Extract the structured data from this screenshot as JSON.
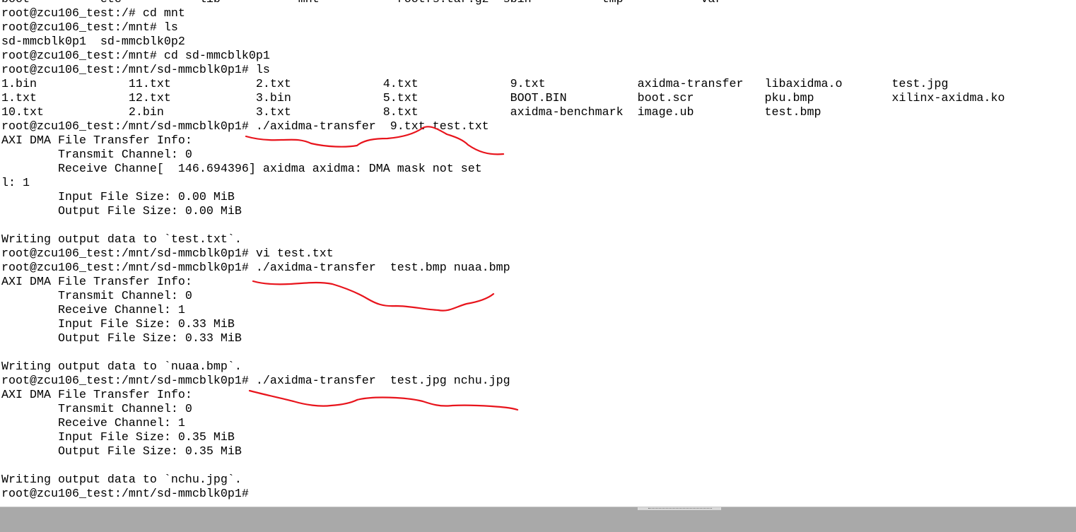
{
  "terminal": {
    "lines": [
      "boot          etc           lib           mnt           rootfs.tar.gz  sbin          tmp           var",
      "root@zcu106_test:/# cd mnt",
      "root@zcu106_test:/mnt# ls",
      "sd-mmcblk0p1  sd-mmcblk0p2",
      "root@zcu106_test:/mnt# cd sd-mmcblk0p1",
      "root@zcu106_test:/mnt/sd-mmcblk0p1# ls",
      "1.bin             11.txt            2.txt             4.txt             9.txt             axidma-transfer   libaxidma.o       test.jpg",
      "1.txt             12.txt            3.bin             5.txt             BOOT.BIN          boot.scr          pku.bmp           xilinx-axidma.ko",
      "10.txt            2.bin             3.txt             8.txt             axidma-benchmark  image.ub          test.bmp",
      "root@zcu106_test:/mnt/sd-mmcblk0p1# ./axidma-transfer  9.txt test.txt",
      "AXI DMA File Transfer Info:",
      "        Transmit Channel: 0",
      "        Receive Channe[  146.694396] axidma axidma: DMA mask not set",
      "l: 1",
      "        Input File Size: 0.00 MiB",
      "        Output File Size: 0.00 MiB",
      "",
      "Writing output data to `test.txt`.",
      "root@zcu106_test:/mnt/sd-mmcblk0p1# vi test.txt",
      "root@zcu106_test:/mnt/sd-mmcblk0p1# ./axidma-transfer  test.bmp nuaa.bmp",
      "AXI DMA File Transfer Info:",
      "        Transmit Channel: 0",
      "        Receive Channel: 1",
      "        Input File Size: 0.33 MiB",
      "        Output File Size: 0.33 MiB",
      "",
      "Writing output data to `nuaa.bmp`.",
      "root@zcu106_test:/mnt/sd-mmcblk0p1# ./axidma-transfer  test.jpg nchu.jpg",
      "AXI DMA File Transfer Info:",
      "        Transmit Channel: 0",
      "        Receive Channel: 1",
      "        Input File Size: 0.35 MiB",
      "        Output File Size: 0.35 MiB",
      "",
      "Writing output data to `nchu.jpg`.",
      "root@zcu106_test:/mnt/sd-mmcblk0p1#"
    ]
  },
  "annotations": {
    "stroke_color": "#e8141c"
  },
  "status_bar": {
    "background_color": "#a9a9a9"
  }
}
